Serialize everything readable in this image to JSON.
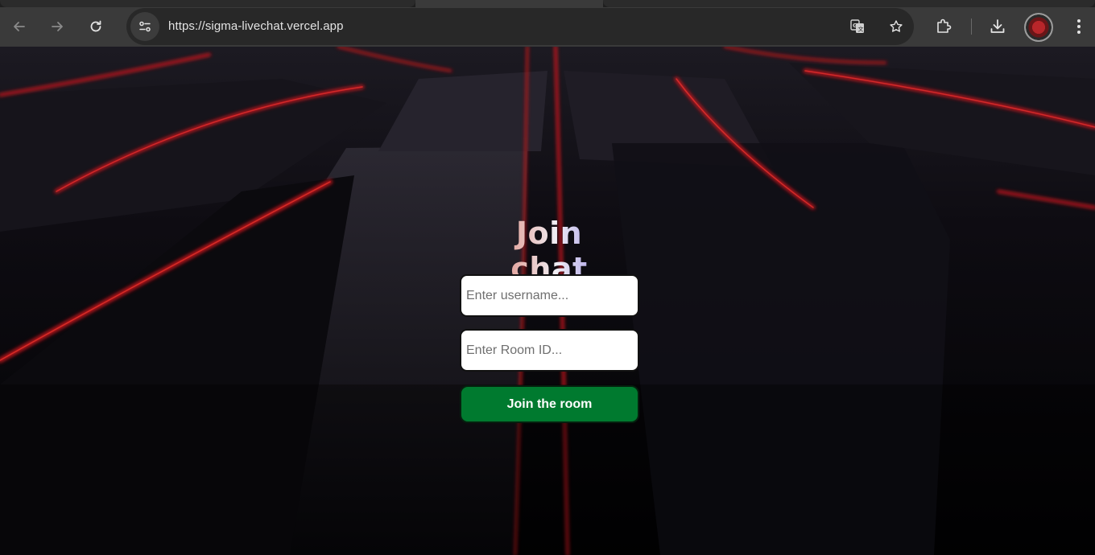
{
  "browser": {
    "url": "https://sigma-livechat.vercel.app",
    "icons": [
      "back-icon",
      "forward-icon",
      "reload-icon",
      "site-info-icon",
      "translate-icon",
      "bookmark-star-icon",
      "extensions-icon",
      "downloads-icon",
      "profile-avatar",
      "menu-kebab-icon"
    ]
  },
  "join": {
    "title": "Join chat",
    "username_placeholder": "Enter username...",
    "room_placeholder": "Enter Room ID...",
    "button_label": "Join the room"
  },
  "colors": {
    "button_bg": "#007a2f",
    "accent_red": "#c8161a",
    "title_gradient_start": "#d2706a",
    "title_gradient_end": "#8f85e0"
  }
}
